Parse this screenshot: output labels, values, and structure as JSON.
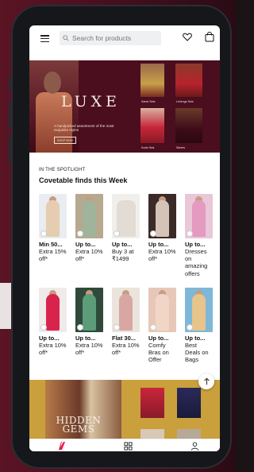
{
  "search": {
    "placeholder": "Search for products"
  },
  "hero": {
    "title": "LUXE",
    "subtitle": "A handpicked assortment of the most exquisite styles",
    "cta": "SHOP NOW",
    "thumbs": [
      {
        "label": "Saree Sets"
      },
      {
        "label": "Lehenga Sets"
      },
      {
        "label": "Kurta Sets"
      },
      {
        "label": "Sarees"
      }
    ]
  },
  "spotlight": {
    "kicker": "IN THE SPOTLIGHT",
    "title": "Covetable finds this Week",
    "row1": [
      {
        "t1": "Min 50...",
        "t2": "Extra 15% off*"
      },
      {
        "t1": "Up to...",
        "t2": "Extra 10% off*"
      },
      {
        "t1": "Up to...",
        "t2": "Buy 3 at ₹1499"
      },
      {
        "t1": "Up to...",
        "t2": "Extra 10% off*"
      },
      {
        "t1": "Up to...",
        "t2": "Dresses on amazing offers"
      }
    ],
    "row2": [
      {
        "t1": "Up to...",
        "t2": "Extra 10% off*"
      },
      {
        "t1": "Up to...",
        "t2": "Extra 10% off*"
      },
      {
        "t1": "Flat 30...",
        "t2": "Extra 10% off*"
      },
      {
        "t1": "Up to...",
        "t2": "Comfy Bras on Offer"
      },
      {
        "t1": "Up to...",
        "t2": "Best Deals on Bags"
      }
    ]
  },
  "gems": {
    "title": "HIDDEN GEMS"
  },
  "colors": {
    "accent": "#e8174b",
    "banner": "#4a0e1f",
    "gems_bg": "#c9a03b"
  }
}
